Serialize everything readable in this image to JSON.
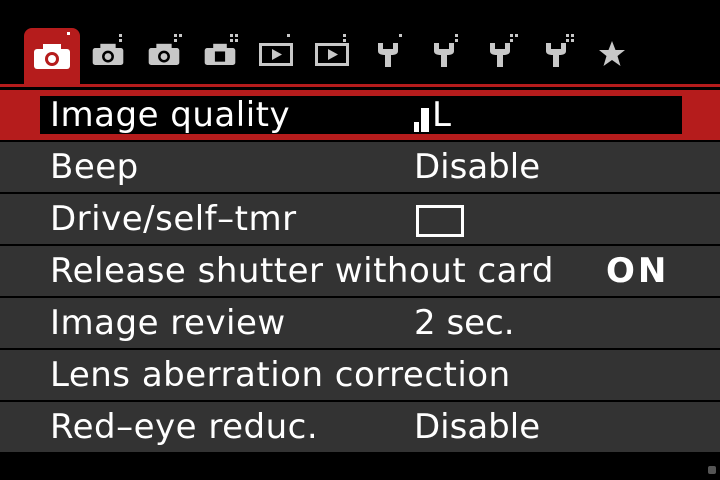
{
  "tabs": [
    {
      "icon": "camera-icon",
      "dots": 1,
      "active": true
    },
    {
      "icon": "camera-icon",
      "dots": 2,
      "active": false
    },
    {
      "icon": "camera-icon",
      "dots": 3,
      "active": false
    },
    {
      "icon": "camera-alt-icon",
      "dots": 4,
      "active": false
    },
    {
      "icon": "playback-icon",
      "dots": 1,
      "active": false
    },
    {
      "icon": "playback-icon",
      "dots": 2,
      "active": false
    },
    {
      "icon": "wrench-icon",
      "dots": 1,
      "active": false
    },
    {
      "icon": "wrench-icon",
      "dots": 2,
      "active": false
    },
    {
      "icon": "wrench-icon",
      "dots": 3,
      "active": false
    },
    {
      "icon": "wrench-icon",
      "dots": 4,
      "active": false
    },
    {
      "icon": "star-icon",
      "dots": 0,
      "active": false
    }
  ],
  "menu": {
    "items": [
      {
        "label": "Image quality",
        "value": "L",
        "value_type": "quality-icon",
        "selected": true
      },
      {
        "label": "Beep",
        "value": "Disable",
        "value_type": "text",
        "selected": false
      },
      {
        "label": "Drive/self–tmr",
        "value": "",
        "value_type": "single-shot-icon",
        "selected": false
      },
      {
        "label": "Release shutter without card",
        "value": "ON",
        "value_type": "text-right",
        "selected": false
      },
      {
        "label": "Image review",
        "value": "2 sec.",
        "value_type": "text",
        "selected": false
      },
      {
        "label": "Lens aberration correction",
        "value": "",
        "value_type": "none",
        "selected": false
      },
      {
        "label": "Red–eye reduc.",
        "value": "Disable",
        "value_type": "text",
        "selected": false
      }
    ]
  },
  "colors": {
    "accent": "#b51c1c",
    "row_bg": "#333333",
    "background": "#000000",
    "text": "#ffffff"
  }
}
